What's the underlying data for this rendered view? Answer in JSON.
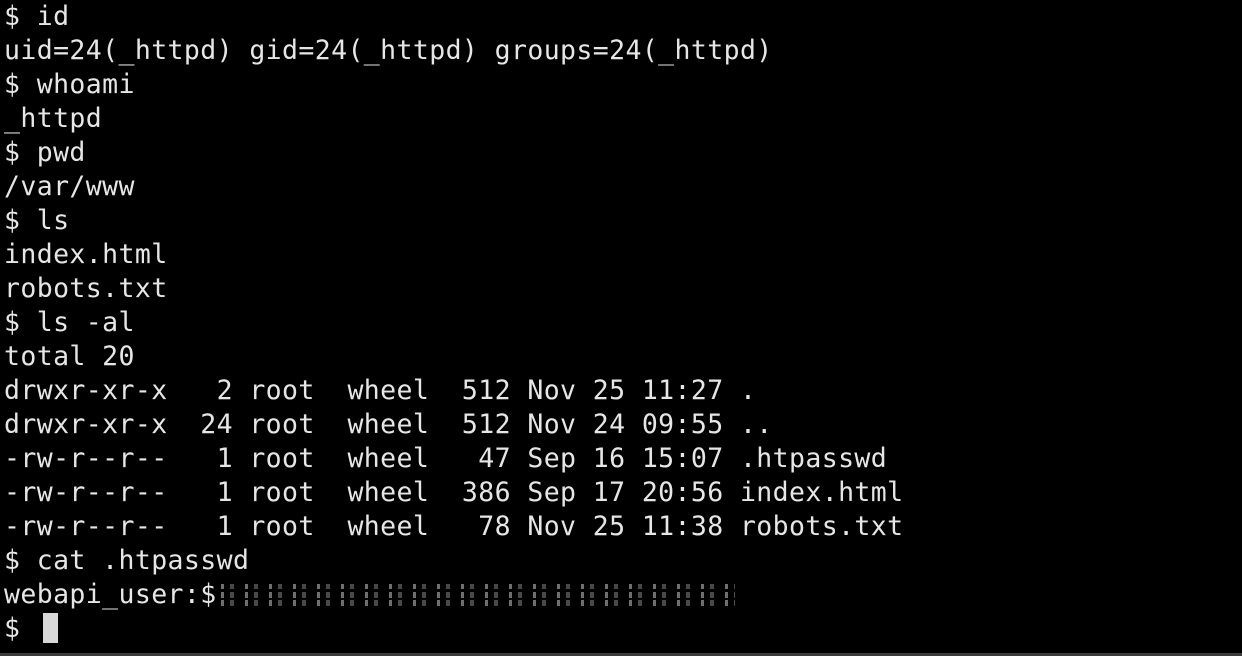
{
  "terminal": {
    "lines": [
      "$ id",
      "uid=24(_httpd) gid=24(_httpd) groups=24(_httpd)",
      "$ whoami",
      "_httpd",
      "$ pwd",
      "/var/www",
      "$ ls",
      "index.html",
      "robots.txt",
      "$ ls -al",
      "total 20",
      "drwxr-xr-x   2 root  wheel  512 Nov 25 11:27 .",
      "drwxr-xr-x  24 root  wheel  512 Nov 24 09:55 ..",
      "-rw-r--r--   1 root  wheel   47 Sep 16 15:07 .htpasswd",
      "-rw-r--r--   1 root  wheel  386 Sep 17 20:56 index.html",
      "-rw-r--r--   1 root  wheel   78 Nov 25 11:38 robots.txt",
      "$ cat .htpasswd"
    ],
    "htpasswd_prefix": "webapi_user:$",
    "prompt": "$ "
  }
}
